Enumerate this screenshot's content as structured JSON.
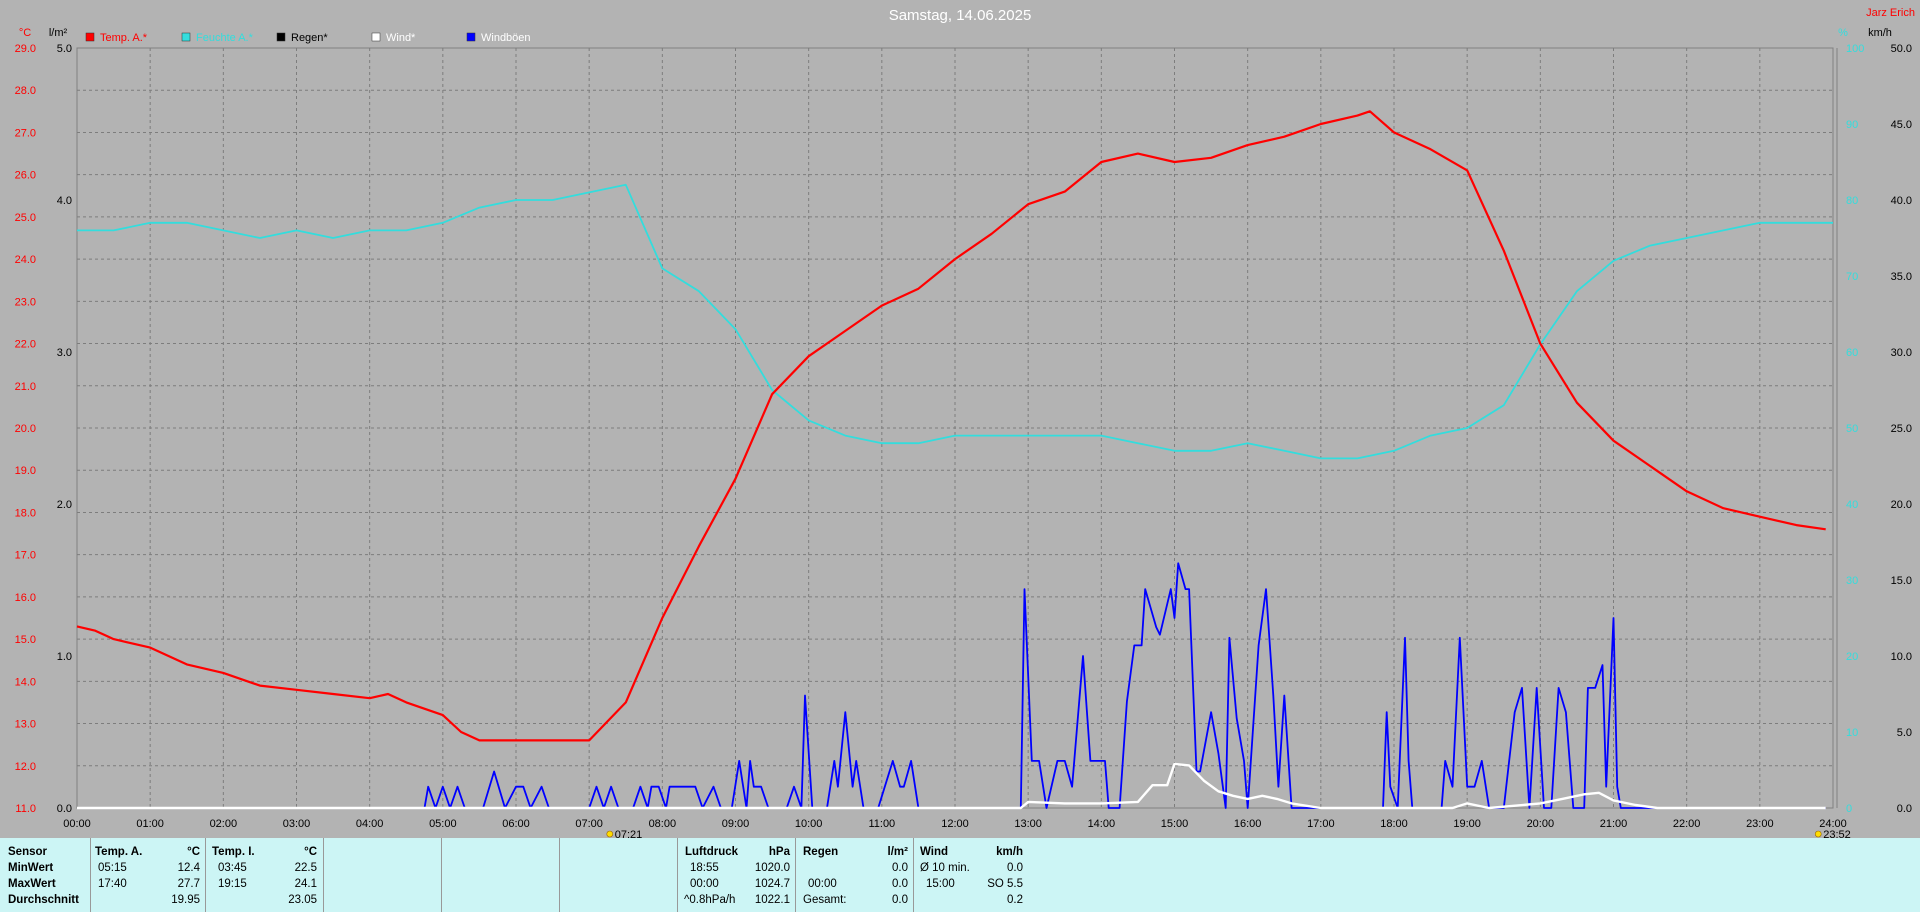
{
  "chart_data": {
    "type": "line",
    "title": "Samstag, 14.06.2025",
    "corner_label": "Jarz Erich",
    "x_ticks": [
      "00:00",
      "01:00",
      "02:00",
      "03:00",
      "04:00",
      "05:00",
      "06:00",
      "07:00",
      "08:00",
      "09:00",
      "10:00",
      "11:00",
      "12:00",
      "13:00",
      "14:00",
      "15:00",
      "16:00",
      "17:00",
      "18:00",
      "19:00",
      "20:00",
      "21:00",
      "22:00",
      "23:00",
      "24:00"
    ],
    "axes": {
      "temp": {
        "unit": "°C",
        "min": 11,
        "max": 29,
        "ticks": [
          "29.0",
          "28.0",
          "27.0",
          "26.0",
          "25.0",
          "24.0",
          "23.0",
          "22.0",
          "21.0",
          "20.0",
          "19.0",
          "18.0",
          "17.0",
          "16.0",
          "15.0",
          "14.0",
          "13.0",
          "12.0",
          "11.0"
        ],
        "color": "#ff0000"
      },
      "rain": {
        "unit": "l/m²",
        "min": 0,
        "max": 5,
        "ticks": [
          "5.0",
          "4.0",
          "3.0",
          "2.0",
          "1.0",
          "0.0"
        ],
        "color": "#000000"
      },
      "humidity": {
        "unit": "%",
        "min": 0,
        "max": 100,
        "ticks": [
          "100",
          "90",
          "80",
          "70",
          "60",
          "50",
          "40",
          "30",
          "20",
          "10",
          "0"
        ],
        "color": "#33dddd"
      },
      "wind": {
        "unit": "km/h",
        "min": 0,
        "max": 50,
        "ticks": [
          "50.0",
          "45.0",
          "40.0",
          "35.0",
          "30.0",
          "25.0",
          "20.0",
          "15.0",
          "10.0",
          "5.0",
          "0.0"
        ],
        "color": "#000000"
      }
    },
    "legend": [
      {
        "label": "Temp. A.*",
        "color": "#ff0000",
        "text_color": "#ff0000"
      },
      {
        "label": "Feuchte A.*",
        "color": "#33dddd",
        "text_color": "#33dddd"
      },
      {
        "label": "Regen*",
        "color": "#000000",
        "text_color": "#000000"
      },
      {
        "label": "Wind*",
        "color": "#ffffff",
        "text_color": "#ffffff"
      },
      {
        "label": "Windböen",
        "color": "#0000ff",
        "text_color": "#ffffff"
      }
    ],
    "sunrise": "07:21",
    "sunset": "23:52",
    "series": [
      {
        "name": "Temp. A.*",
        "color": "#ff0000",
        "axis": "temp",
        "points": [
          [
            0,
            15.3
          ],
          [
            0.25,
            15.2
          ],
          [
            0.5,
            15.0
          ],
          [
            1,
            14.8
          ],
          [
            1.5,
            14.4
          ],
          [
            2,
            14.2
          ],
          [
            2.5,
            13.9
          ],
          [
            3,
            13.8
          ],
          [
            3.5,
            13.7
          ],
          [
            4,
            13.6
          ],
          [
            4.25,
            13.7
          ],
          [
            4.5,
            13.5
          ],
          [
            5,
            13.2
          ],
          [
            5.25,
            12.8
          ],
          [
            5.5,
            12.6
          ],
          [
            6,
            12.6
          ],
          [
            6.5,
            12.6
          ],
          [
            7,
            12.6
          ],
          [
            7.5,
            13.5
          ],
          [
            8,
            15.5
          ],
          [
            8.5,
            17.2
          ],
          [
            9,
            18.8
          ],
          [
            9.5,
            20.8
          ],
          [
            10,
            21.7
          ],
          [
            10.5,
            22.3
          ],
          [
            11,
            22.9
          ],
          [
            11.5,
            23.3
          ],
          [
            12,
            24.0
          ],
          [
            12.5,
            24.6
          ],
          [
            13,
            25.3
          ],
          [
            13.5,
            25.6
          ],
          [
            14,
            26.3
          ],
          [
            14.5,
            26.5
          ],
          [
            15,
            26.3
          ],
          [
            15.5,
            26.4
          ],
          [
            16,
            26.7
          ],
          [
            16.5,
            26.9
          ],
          [
            17,
            27.2
          ],
          [
            17.5,
            27.4
          ],
          [
            17.67,
            27.5
          ],
          [
            18,
            27.0
          ],
          [
            18.5,
            26.6
          ],
          [
            19,
            26.1
          ],
          [
            19.5,
            24.2
          ],
          [
            20,
            22.0
          ],
          [
            20.5,
            20.6
          ],
          [
            21,
            19.7
          ],
          [
            21.5,
            19.1
          ],
          [
            22,
            18.5
          ],
          [
            22.5,
            18.1
          ],
          [
            23,
            17.9
          ],
          [
            23.5,
            17.7
          ],
          [
            23.9,
            17.6
          ]
        ]
      },
      {
        "name": "Feuchte A.*",
        "color": "#33dddd",
        "axis": "humidity",
        "points": [
          [
            0,
            76
          ],
          [
            0.5,
            76
          ],
          [
            1,
            77
          ],
          [
            1.5,
            77
          ],
          [
            2,
            76
          ],
          [
            2.5,
            75
          ],
          [
            3,
            76
          ],
          [
            3.5,
            75
          ],
          [
            4,
            76
          ],
          [
            4.5,
            76
          ],
          [
            5,
            77
          ],
          [
            5.5,
            79
          ],
          [
            6,
            80
          ],
          [
            6.5,
            80
          ],
          [
            7,
            81
          ],
          [
            7.5,
            82
          ],
          [
            8,
            71
          ],
          [
            8.5,
            68
          ],
          [
            9,
            63
          ],
          [
            9.5,
            55
          ],
          [
            10,
            51
          ],
          [
            10.5,
            49
          ],
          [
            11,
            48
          ],
          [
            11.5,
            48
          ],
          [
            12,
            49
          ],
          [
            12.5,
            49
          ],
          [
            13,
            49
          ],
          [
            13.5,
            49
          ],
          [
            14,
            49
          ],
          [
            14.5,
            48
          ],
          [
            15,
            47
          ],
          [
            15.5,
            47
          ],
          [
            16,
            48
          ],
          [
            16.5,
            47
          ],
          [
            17,
            46
          ],
          [
            17.5,
            46
          ],
          [
            18,
            47
          ],
          [
            18.5,
            49
          ],
          [
            19,
            50
          ],
          [
            19.5,
            53
          ],
          [
            20,
            61
          ],
          [
            20.5,
            68
          ],
          [
            21,
            72
          ],
          [
            21.5,
            74
          ],
          [
            22,
            75
          ],
          [
            22.5,
            76
          ],
          [
            23,
            77
          ],
          [
            23.5,
            77
          ],
          [
            24,
            77
          ]
        ]
      },
      {
        "name": "Wind*",
        "color": "#ffffff",
        "axis": "wind",
        "points": [
          [
            0,
            0
          ],
          [
            11.5,
            0
          ],
          [
            12.9,
            0
          ],
          [
            13,
            0.4
          ],
          [
            13.5,
            0.3
          ],
          [
            14,
            0.3
          ],
          [
            14.5,
            0.4
          ],
          [
            14.7,
            1.5
          ],
          [
            14.9,
            1.5
          ],
          [
            15,
            2.9
          ],
          [
            15.2,
            2.8
          ],
          [
            15.4,
            1.8
          ],
          [
            15.6,
            1.1
          ],
          [
            15.8,
            0.8
          ],
          [
            16,
            0.6
          ],
          [
            16.2,
            0.8
          ],
          [
            16.4,
            0.6
          ],
          [
            16.6,
            0.3
          ],
          [
            17,
            0
          ],
          [
            18.8,
            0
          ],
          [
            19,
            0.3
          ],
          [
            19.3,
            0
          ],
          [
            20,
            0.3
          ],
          [
            20.3,
            0.6
          ],
          [
            20.6,
            0.9
          ],
          [
            20.8,
            1.0
          ],
          [
            21,
            0.5
          ],
          [
            21.3,
            0.2
          ],
          [
            21.6,
            0
          ],
          [
            23.9,
            0
          ]
        ]
      },
      {
        "name": "Windböen",
        "color": "#0000ff",
        "axis": "wind",
        "points": [
          [
            0,
            0
          ],
          [
            4.75,
            0
          ],
          [
            4.8,
            1.4
          ],
          [
            4.9,
            0
          ],
          [
            5,
            1.4
          ],
          [
            5.1,
            0
          ],
          [
            5.2,
            1.4
          ],
          [
            5.3,
            0
          ],
          [
            5.55,
            0
          ],
          [
            5.7,
            2.4
          ],
          [
            5.85,
            0
          ],
          [
            6,
            1.4
          ],
          [
            6.1,
            1.4
          ],
          [
            6.2,
            0
          ],
          [
            6.35,
            1.4
          ],
          [
            6.45,
            0
          ],
          [
            7,
            0
          ],
          [
            7.1,
            1.4
          ],
          [
            7.2,
            0
          ],
          [
            7.3,
            1.4
          ],
          [
            7.4,
            0
          ],
          [
            7.6,
            0
          ],
          [
            7.7,
            1.4
          ],
          [
            7.8,
            0
          ],
          [
            7.85,
            1.4
          ],
          [
            7.95,
            1.4
          ],
          [
            8.05,
            0
          ],
          [
            8.1,
            1.4
          ],
          [
            8.3,
            1.4
          ],
          [
            8.45,
            1.4
          ],
          [
            8.55,
            0
          ],
          [
            8.7,
            1.4
          ],
          [
            8.8,
            0
          ],
          [
            8.95,
            0
          ],
          [
            9.05,
            3.1
          ],
          [
            9.15,
            0
          ],
          [
            9.2,
            3.1
          ],
          [
            9.25,
            1.4
          ],
          [
            9.35,
            1.4
          ],
          [
            9.45,
            0
          ],
          [
            9.7,
            0
          ],
          [
            9.8,
            1.4
          ],
          [
            9.9,
            0
          ],
          [
            9.95,
            7.4
          ],
          [
            10.05,
            0
          ],
          [
            10.25,
            0
          ],
          [
            10.35,
            3.1
          ],
          [
            10.4,
            1.4
          ],
          [
            10.5,
            6.3
          ],
          [
            10.6,
            1.4
          ],
          [
            10.65,
            3.1
          ],
          [
            10.75,
            0
          ],
          [
            10.95,
            0
          ],
          [
            11.15,
            3.1
          ],
          [
            11.25,
            1.4
          ],
          [
            11.3,
            1.4
          ],
          [
            11.4,
            3.1
          ],
          [
            11.5,
            0
          ],
          [
            12.9,
            0
          ],
          [
            12.95,
            14.4
          ],
          [
            13.05,
            3.1
          ],
          [
            13.15,
            3.1
          ],
          [
            13.25,
            0
          ],
          [
            13.4,
            3.1
          ],
          [
            13.5,
            3.1
          ],
          [
            13.6,
            1.4
          ],
          [
            13.75,
            10.0
          ],
          [
            13.85,
            3.1
          ],
          [
            14.05,
            3.1
          ],
          [
            14.1,
            0
          ],
          [
            14.25,
            0
          ],
          [
            14.35,
            7.0
          ],
          [
            14.45,
            10.7
          ],
          [
            14.55,
            10.7
          ],
          [
            14.6,
            14.4
          ],
          [
            14.75,
            11.9
          ],
          [
            14.8,
            11.4
          ],
          [
            14.95,
            14.4
          ],
          [
            15,
            12.5
          ],
          [
            15.05,
            16.1
          ],
          [
            15.15,
            14.4
          ],
          [
            15.2,
            14.4
          ],
          [
            15.3,
            2.4
          ],
          [
            15.35,
            2.4
          ],
          [
            15.5,
            6.3
          ],
          [
            15.6,
            3.6
          ],
          [
            15.7,
            0
          ],
          [
            15.75,
            11.2
          ],
          [
            15.85,
            5.9
          ],
          [
            15.95,
            3.1
          ],
          [
            16,
            0
          ],
          [
            16.15,
            10.7
          ],
          [
            16.25,
            14.4
          ],
          [
            16.35,
            7.4
          ],
          [
            16.42,
            1.4
          ],
          [
            16.5,
            7.4
          ],
          [
            16.6,
            0
          ],
          [
            17.85,
            0
          ],
          [
            17.9,
            6.3
          ],
          [
            17.95,
            1.4
          ],
          [
            18.05,
            0
          ],
          [
            18.15,
            11.2
          ],
          [
            18.2,
            3.1
          ],
          [
            18.25,
            0
          ],
          [
            18.65,
            0
          ],
          [
            18.7,
            3.1
          ],
          [
            18.8,
            1.4
          ],
          [
            18.9,
            11.2
          ],
          [
            19,
            1.4
          ],
          [
            19.1,
            1.4
          ],
          [
            19.2,
            3.1
          ],
          [
            19.3,
            0
          ],
          [
            19.5,
            0
          ],
          [
            19.65,
            6.3
          ],
          [
            19.75,
            7.9
          ],
          [
            19.85,
            0
          ],
          [
            19.95,
            7.9
          ],
          [
            20.05,
            0
          ],
          [
            20.15,
            0
          ],
          [
            20.25,
            7.9
          ],
          [
            20.35,
            6.3
          ],
          [
            20.45,
            0
          ],
          [
            20.6,
            0
          ],
          [
            20.65,
            7.9
          ],
          [
            20.75,
            7.9
          ],
          [
            20.85,
            9.4
          ],
          [
            20.9,
            1.4
          ],
          [
            21,
            12.5
          ],
          [
            21.05,
            1.4
          ],
          [
            21.1,
            0
          ],
          [
            23.9,
            0
          ]
        ]
      }
    ]
  },
  "stats": {
    "sensor_h": "Sensor",
    "min_h": "MinWert",
    "max_h": "MaxWert",
    "avg_h": "Durchschnitt",
    "temp_a": {
      "h": "Temp. A.",
      "unit": "°C",
      "min_t": "05:15",
      "min_v": "12.4",
      "max_t": "17:40",
      "max_v": "27.7",
      "avg": "19.95"
    },
    "temp_i": {
      "h": "Temp. I.",
      "unit": "°C",
      "min_t": "03:45",
      "min_v": "22.5",
      "max_t": "19:15",
      "max_v": "24.1",
      "avg": "23.05"
    },
    "press": {
      "h": "Luftdruck",
      "unit": "hPa",
      "r1_t": "18:55",
      "r1_v": "1020.0",
      "r2_t": "00:00",
      "r2_v": "1024.7",
      "r3_t": "^0.8hPa/h",
      "r3_v": "1022.1"
    },
    "rain": {
      "h": "Regen",
      "unit": "l/m²",
      "r2_t": "00:00",
      "r2_v": "0.0",
      "r1_v": "0.0",
      "r3_t": "Gesamt:",
      "r3_v": "0.0"
    },
    "wind": {
      "h": "Wind",
      "unit": "km/h",
      "r1_t": "Ø 10 min.",
      "r1_v": "0.0",
      "r2_t": "15:00",
      "r2_v": "SO 5.5",
      "r3_v": "0.2"
    }
  }
}
